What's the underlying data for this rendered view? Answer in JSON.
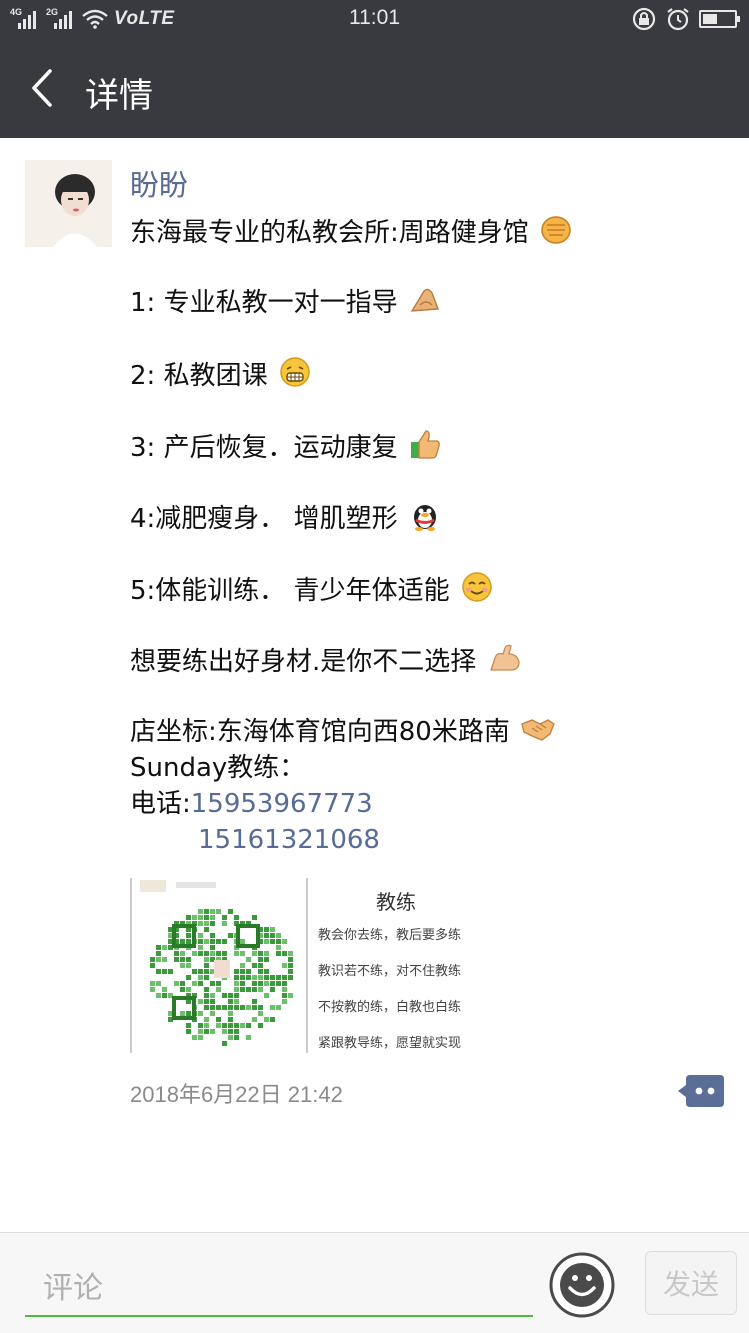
{
  "status_bar": {
    "sim1_tag": "4G",
    "sim2_tag": "2G",
    "network_label": "VoLTE",
    "time": "11:01"
  },
  "header": {
    "title": "详情"
  },
  "post": {
    "author": "盼盼",
    "lines": {
      "headline": "东海最专业的私教会所:周路健身馆",
      "item1": "1: 专业私教一对一指导",
      "item2": "2: 私教团课",
      "item3": "3: 产后恢复．运动康复",
      "item4": "4:减肥瘦身．  增肌塑形",
      "item5": "5:体能训练．  青少年体适能",
      "slogan": "想要练出好身材.是你不二选择",
      "location": "店坐标:东海体育馆向西80米路南",
      "coach": " Sunday教练：",
      "phone_label": "电话:",
      "phone1": "15953967773",
      "phone2": "15161321068"
    },
    "image": {
      "title": "教练",
      "lines": [
        "教会你去练，教后要多练",
        "教识若不练，对不住教练",
        "不按教的练，白教也白练",
        "紧跟教导练，愿望就实现"
      ]
    },
    "timestamp": "2018年6月22日 21:42"
  },
  "comment_bar": {
    "placeholder": "评论",
    "send_label": "发送"
  },
  "colors": {
    "bar_bg": "#393a3f",
    "link": "#576b95",
    "input_underline": "#4cba43"
  }
}
